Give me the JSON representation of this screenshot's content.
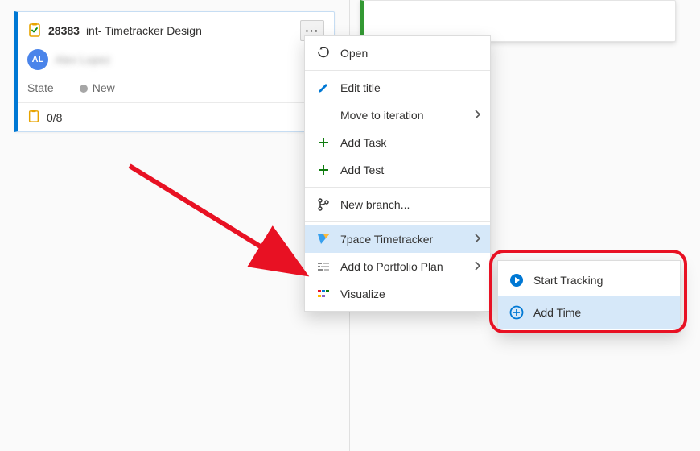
{
  "card": {
    "id": "28383",
    "title": "int- Timetracker Design",
    "assignee_initials": "AL",
    "assignee_name": "Alex Lopez",
    "state_label": "State",
    "state_value": "New",
    "task_count": "0/8"
  },
  "menu": {
    "open": "Open",
    "edit_title": "Edit title",
    "move_to_iteration": "Move to iteration",
    "add_task": "Add Task",
    "add_test": "Add Test",
    "new_branch": "New branch...",
    "timetracker": "7pace Timetracker",
    "portfolio": "Add to Portfolio Plan",
    "visualize": "Visualize"
  },
  "submenu": {
    "start_tracking": "Start Tracking",
    "add_time": "Add Time"
  },
  "icons": {
    "more": "···"
  }
}
